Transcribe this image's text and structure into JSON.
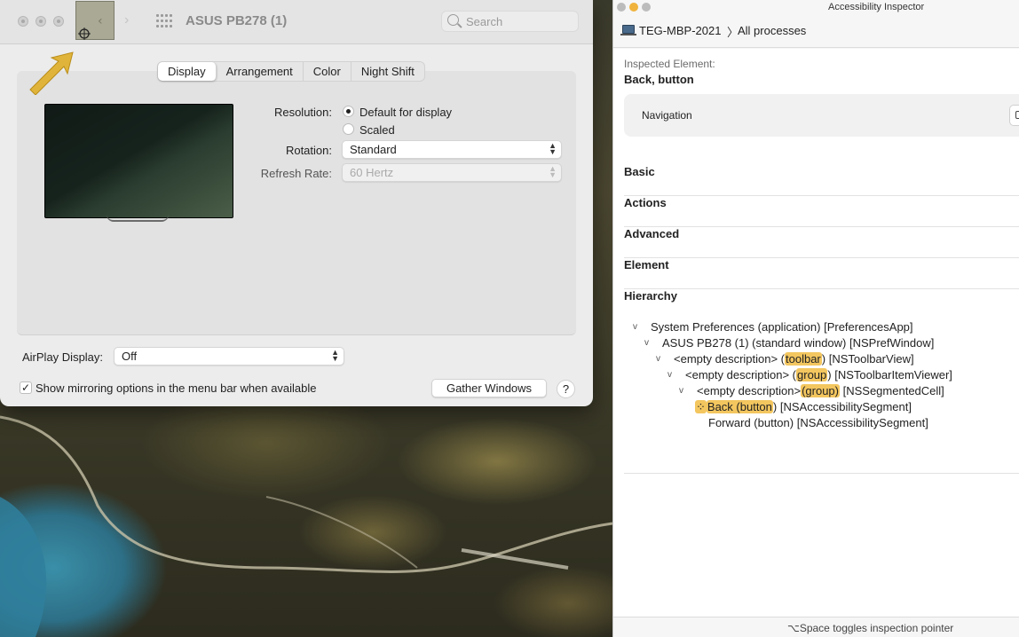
{
  "prefs_window": {
    "title": "ASUS PB278 (1)",
    "search_placeholder": "Search",
    "tabs": [
      {
        "label": "Display",
        "active": true
      },
      {
        "label": "Arrangement",
        "active": false
      },
      {
        "label": "Color",
        "active": false
      },
      {
        "label": "Night Shift",
        "active": false
      }
    ],
    "resolution": {
      "label": "Resolution:",
      "options": [
        {
          "label": "Default for display",
          "selected": true
        },
        {
          "label": "Scaled",
          "selected": false
        }
      ]
    },
    "rotation": {
      "label": "Rotation:",
      "value": "Standard"
    },
    "refresh_rate": {
      "label": "Refresh Rate:",
      "value": "60 Hertz",
      "enabled": false
    },
    "airplay": {
      "label": "AirPlay Display:",
      "value": "Off"
    },
    "mirroring": {
      "label": "Show mirroring options in the menu bar when available",
      "checked": true,
      "check_glyph": "✓"
    },
    "gather_button": "Gather Windows",
    "help_label": "?"
  },
  "inspector": {
    "title": "Accessibility Inspector",
    "host": "TEG-MBP-2021",
    "separator": "〉",
    "target": "All processes",
    "inspected_label": "Inspected Element:",
    "inspected_value": "Back, button",
    "navigation_label": "Navigation",
    "sections": [
      "Basic",
      "Actions",
      "Advanced",
      "Element",
      "Hierarchy"
    ],
    "hierarchy": {
      "row1": "System Preferences (application) [PreferencesApp]",
      "row2": "ASUS PB278 (1) (standard window) [NSPrefWindow]",
      "row3": {
        "pre": "<empty description> (",
        "hl": "toolbar",
        "post": ") [NSToolbarView]"
      },
      "row4": {
        "pre": "<empty description> (",
        "hl": "group",
        "post": ") [NSToolbarItemViewer]"
      },
      "row5": {
        "pre": "<empty description>",
        "hl": "(group)",
        "post": " [NSSegmentedCell]"
      },
      "row6": {
        "hl": "Back (button",
        "post": ") [NSAccessibilitySegment]"
      },
      "row7": "Forward (button) [NSAccessibilitySegment]"
    },
    "footer": "⌥Space toggles inspection pointer",
    "colors": {
      "highlight": "#f3c65f"
    }
  }
}
